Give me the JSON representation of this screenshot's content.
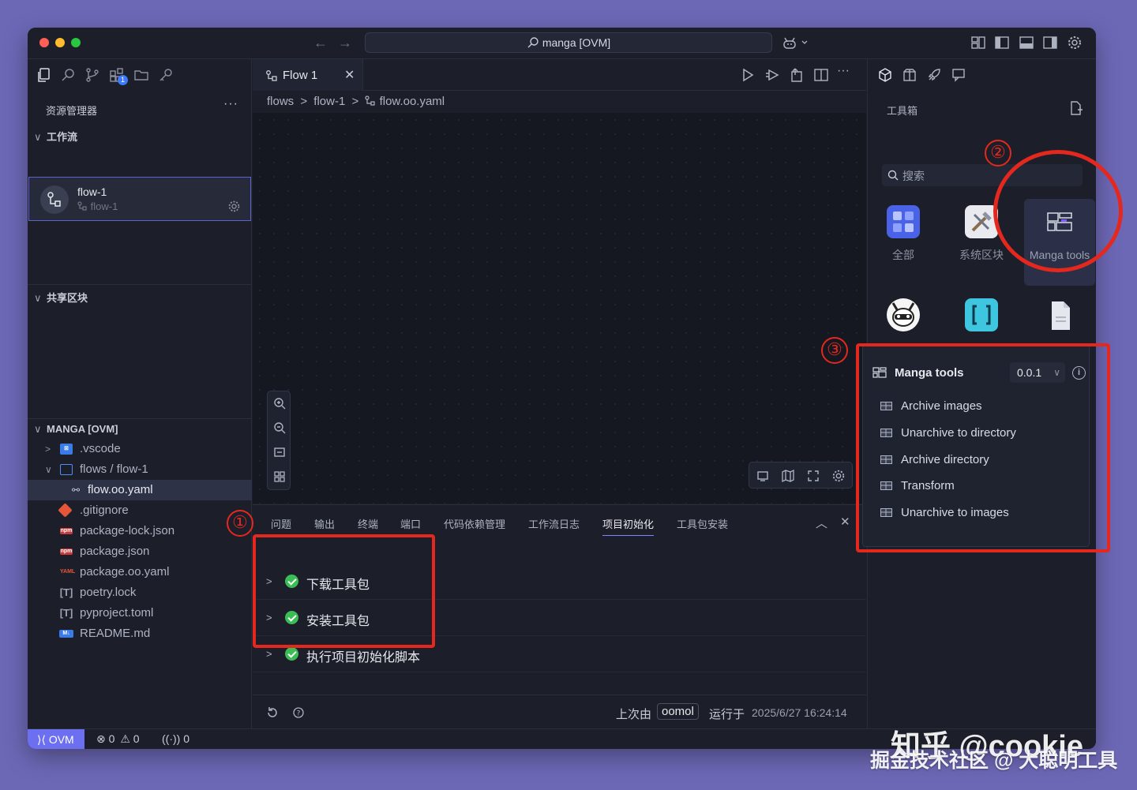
{
  "titlebar": {
    "search_text": "manga [OVM]"
  },
  "sidebar": {
    "title": "资源管理器",
    "more": "···",
    "workflow_section": "工作流",
    "flow_card": {
      "name": "flow-1",
      "sub": "flow-1"
    },
    "shared_section": "共享区块",
    "project_section": "MANGA [OVM]",
    "tree": [
      {
        "name": ".vscode",
        "icon": "vscode-folder-icon",
        "badge": ""
      },
      {
        "name": "flows / flow-1",
        "icon": "folder-icon",
        "badge": ""
      },
      {
        "name": "flow.oo.yaml",
        "icon": "flow-file-icon",
        "badge": ""
      },
      {
        "name": ".gitignore",
        "icon": "git-icon",
        "badge": ""
      },
      {
        "name": "package-lock.json",
        "icon": "npm-icon",
        "badge": "npm"
      },
      {
        "name": "package.json",
        "icon": "npm-icon",
        "badge": "npm"
      },
      {
        "name": "package.oo.yaml",
        "icon": "yaml-icon",
        "badge": "YAML"
      },
      {
        "name": "poetry.lock",
        "icon": "toml-icon",
        "badge": "[T]"
      },
      {
        "name": "pyproject.toml",
        "icon": "toml-icon",
        "badge": "[T]"
      },
      {
        "name": "README.md",
        "icon": "markdown-icon",
        "badge": "M↓"
      }
    ],
    "activity_badge": "1"
  },
  "editor": {
    "tab_label": "Flow 1",
    "breadcrumb": [
      "flows",
      "flow-1",
      "flow.oo.yaml"
    ]
  },
  "panel": {
    "tabs": [
      "问题",
      "输出",
      "终端",
      "端口",
      "代码依赖管理",
      "工作流日志",
      "项目初始化",
      "工具包安装"
    ],
    "active_tab": "项目初始化",
    "steps": [
      "下载工具包",
      "安装工具包",
      "执行项目初始化脚本"
    ],
    "footer": {
      "last_by": "上次由",
      "user": "oomol",
      "ran_at": "运行于",
      "time": "2025/6/27 16:24:14"
    }
  },
  "toolbox": {
    "title": "工具箱",
    "search_placeholder": "搜索",
    "categories": [
      {
        "label": "全部",
        "icon": "all-grid-icon"
      },
      {
        "label": "系统区块",
        "icon": "tools-icon"
      },
      {
        "label": "Manga tools",
        "icon": "manga-icon"
      },
      {
        "label": "LLM",
        "icon": "llm-icon"
      },
      {
        "label": "Array",
        "icon": "array-icon"
      },
      {
        "label": "File",
        "icon": "file-icon"
      }
    ],
    "package": {
      "title": "Manga tools",
      "version": "0.0.1",
      "items": [
        "Archive images",
        "Unarchive to directory",
        "Archive directory",
        "Transform",
        "Unarchive to images"
      ]
    }
  },
  "statusbar": {
    "env": "OVM",
    "errors": "0",
    "warnings": "0",
    "ports": "0"
  },
  "annotations": [
    "①",
    "②",
    "③"
  ],
  "watermark": {
    "line1": "知乎 @cookie",
    "line2": "掘金技术社区 @ 大聪明工具"
  },
  "colors": {
    "accent": "#6b6ff0",
    "annotation": "#e5281e",
    "success": "#3bbd56",
    "background": "#6d68b6"
  }
}
